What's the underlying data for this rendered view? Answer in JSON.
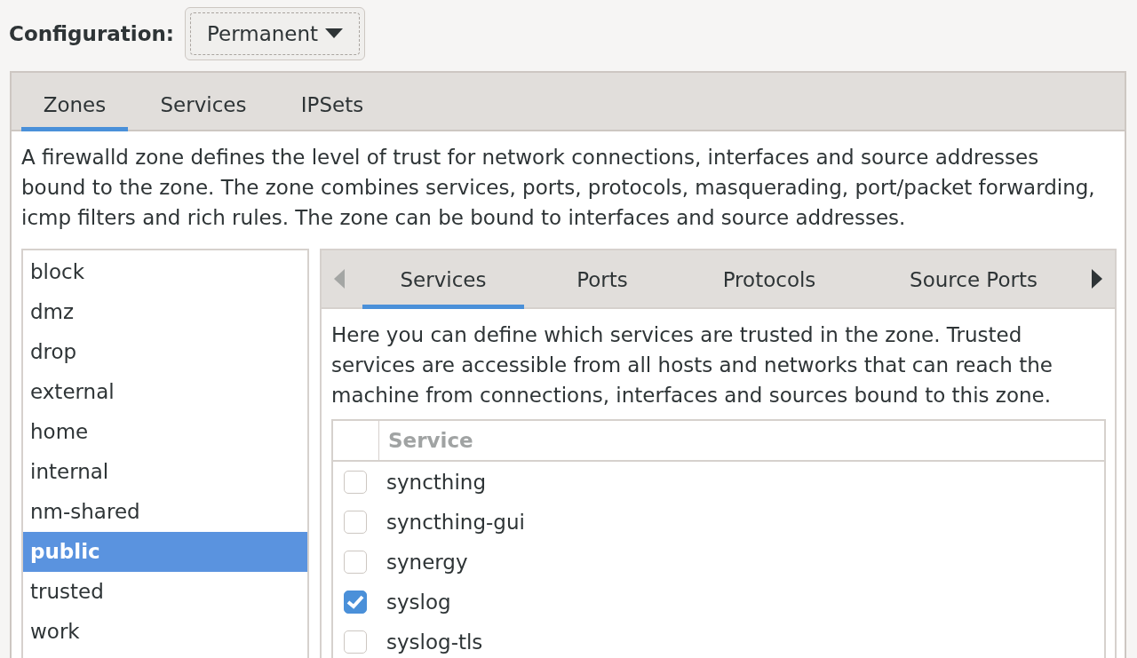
{
  "configuration": {
    "label": "Configuration:",
    "value": "Permanent"
  },
  "tabs": [
    {
      "label": "Zones",
      "selected": true
    },
    {
      "label": "Services",
      "selected": false
    },
    {
      "label": "IPSets",
      "selected": false
    }
  ],
  "zones_description": "A firewalld zone defines the level of trust for network connections, interfaces and source addresses bound to the zone. The zone combines services, ports, protocols, masquerading, port/packet forwarding, icmp filters and rich rules. The zone can be bound to interfaces and source addresses.",
  "zones": [
    {
      "name": "block",
      "selected": false
    },
    {
      "name": "dmz",
      "selected": false
    },
    {
      "name": "drop",
      "selected": false
    },
    {
      "name": "external",
      "selected": false
    },
    {
      "name": "home",
      "selected": false
    },
    {
      "name": "internal",
      "selected": false
    },
    {
      "name": "nm-shared",
      "selected": false
    },
    {
      "name": "public",
      "selected": true
    },
    {
      "name": "trusted",
      "selected": false
    },
    {
      "name": "work",
      "selected": false
    }
  ],
  "zone_tabs": {
    "scroll_left_disabled": true,
    "scroll_right_disabled": false,
    "tabs": [
      {
        "label": "Services",
        "selected": true
      },
      {
        "label": "Ports",
        "selected": false
      },
      {
        "label": "Protocols",
        "selected": false
      },
      {
        "label": "Source Ports",
        "selected": false
      }
    ]
  },
  "services_description": "Here you can define which services are trusted in the zone. Trusted services are accessible from all hosts and networks that can reach the machine from connections, interfaces and sources bound to this zone.",
  "services_table": {
    "columns": [
      "Service"
    ],
    "rows": [
      {
        "name": "syncthing",
        "checked": false
      },
      {
        "name": "syncthing-gui",
        "checked": false
      },
      {
        "name": "synergy",
        "checked": false
      },
      {
        "name": "syslog",
        "checked": true
      },
      {
        "name": "syslog-tls",
        "checked": false
      }
    ]
  }
}
